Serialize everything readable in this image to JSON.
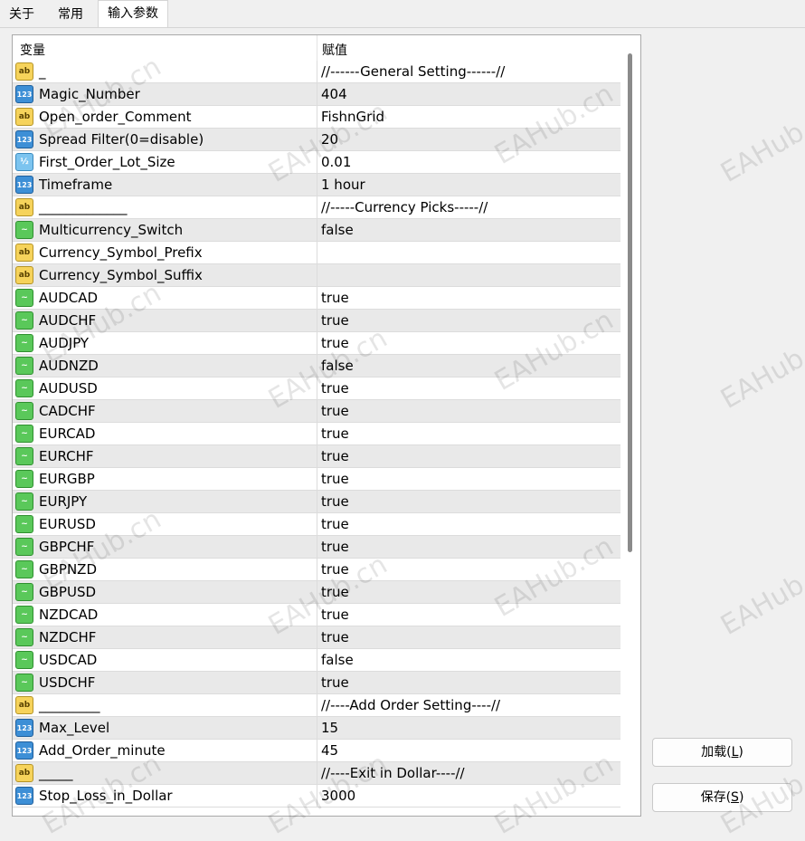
{
  "tabs": [
    {
      "label": "关于",
      "active": false
    },
    {
      "label": "常用",
      "active": false
    },
    {
      "label": "输入参数",
      "active": true
    }
  ],
  "table": {
    "columns": {
      "variable": "变量",
      "value": "赋值"
    },
    "rows": [
      {
        "type": "ab",
        "name": "_",
        "value": "//------General Setting------//"
      },
      {
        "type": "123",
        "name": "Magic_Number",
        "value": "404"
      },
      {
        "type": "ab",
        "name": "Open_order_Comment",
        "value": "FishnGrid"
      },
      {
        "type": "123",
        "name": "Spread Filter(0=disable)",
        "value": "20"
      },
      {
        "type": "half",
        "name": "First_Order_Lot_Size",
        "value": "0.01"
      },
      {
        "type": "123",
        "name": "Timeframe",
        "value": "1 hour"
      },
      {
        "type": "ab",
        "name": "_____________",
        "value": "//-----Currency Picks-----//"
      },
      {
        "type": "bool",
        "name": "Multicurrency_Switch",
        "value": "false"
      },
      {
        "type": "ab",
        "name": "Currency_Symbol_Prefix",
        "value": ""
      },
      {
        "type": "ab",
        "name": "Currency_Symbol_Suffix",
        "value": ""
      },
      {
        "type": "bool",
        "name": "AUDCAD",
        "value": "true"
      },
      {
        "type": "bool",
        "name": "AUDCHF",
        "value": "true"
      },
      {
        "type": "bool",
        "name": "AUDJPY",
        "value": "true"
      },
      {
        "type": "bool",
        "name": "AUDNZD",
        "value": "false"
      },
      {
        "type": "bool",
        "name": "AUDUSD",
        "value": "true"
      },
      {
        "type": "bool",
        "name": "CADCHF",
        "value": "true"
      },
      {
        "type": "bool",
        "name": "EURCAD",
        "value": "true"
      },
      {
        "type": "bool",
        "name": "EURCHF",
        "value": "true"
      },
      {
        "type": "bool",
        "name": "EURGBP",
        "value": "true"
      },
      {
        "type": "bool",
        "name": "EURJPY",
        "value": "true"
      },
      {
        "type": "bool",
        "name": "EURUSD",
        "value": "true"
      },
      {
        "type": "bool",
        "name": "GBPCHF",
        "value": "true"
      },
      {
        "type": "bool",
        "name": "GBPNZD",
        "value": "true"
      },
      {
        "type": "bool",
        "name": "GBPUSD",
        "value": "true"
      },
      {
        "type": "bool",
        "name": "NZDCAD",
        "value": "true"
      },
      {
        "type": "bool",
        "name": "NZDCHF",
        "value": "true"
      },
      {
        "type": "bool",
        "name": "USDCAD",
        "value": "false"
      },
      {
        "type": "bool",
        "name": "USDCHF",
        "value": "true"
      },
      {
        "type": "ab",
        "name": "_________",
        "value": "//----Add Order Setting----//"
      },
      {
        "type": "123",
        "name": "Max_Level",
        "value": "15"
      },
      {
        "type": "123",
        "name": "Add_Order_minute",
        "value": "45"
      },
      {
        "type": "ab",
        "name": "_____",
        "value": "//----Exit in Dollar----//"
      },
      {
        "type": "123",
        "name": "Stop_Loss_in_Dollar",
        "value": "3000"
      }
    ]
  },
  "icons": {
    "ab": "ab",
    "123": "123",
    "half": "½",
    "bool": "~"
  },
  "buttons": {
    "load": {
      "label": "加载(",
      "key": "L",
      "end": ")"
    },
    "save": {
      "label": "保存(",
      "key": "S",
      "end": ")"
    }
  },
  "watermark": "EAHub.cn",
  "colors": {
    "row_alt": "#e9e9e9",
    "grid_border": "#a9a9a9"
  }
}
